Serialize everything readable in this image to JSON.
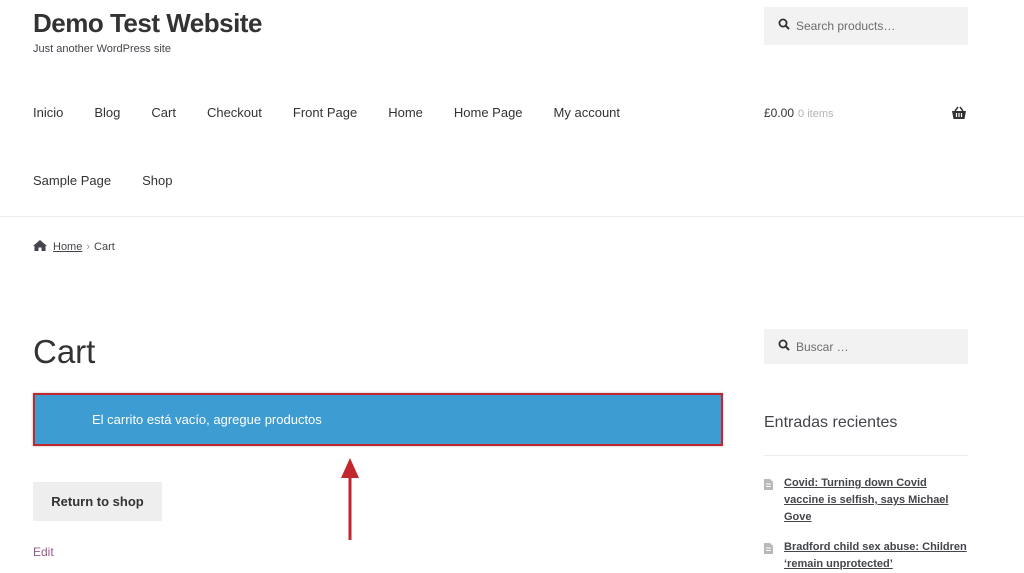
{
  "site": {
    "title": "Demo Test Website",
    "tagline": "Just another WordPress site"
  },
  "header_search": {
    "placeholder": "Search products…"
  },
  "nav": {
    "row1": [
      "Inicio",
      "Blog",
      "Cart",
      "Checkout",
      "Front Page",
      "Home",
      "Home Page",
      "My account"
    ],
    "row2": [
      "Sample Page",
      "Shop"
    ]
  },
  "mini_cart": {
    "total": "£0.00",
    "count": "0 items"
  },
  "breadcrumb": {
    "home": "Home",
    "separator": "›",
    "current": "Cart"
  },
  "page": {
    "title": "Cart",
    "notice": "El carrito está vacío, agregue productos",
    "return_button": "Return to shop",
    "edit_link": "Edit"
  },
  "sidebar": {
    "search_placeholder": "Buscar …",
    "recent_title": "Entradas recientes",
    "recent_posts": [
      "Covid: Turning down Covid vaccine is selfish, says Michael Gove",
      "Bradford child sex abuse: Children ‘remain unprotected’"
    ]
  },
  "colors": {
    "notice_bg": "#3d9cd2",
    "annotation_red": "#c1272d",
    "link_purple": "#96588a"
  }
}
